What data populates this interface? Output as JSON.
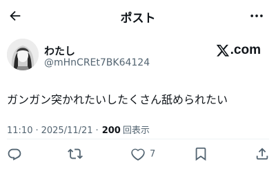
{
  "header": {
    "title": "ポスト",
    "back_icon": "arrow-left-icon",
    "more_icon": "more-horizontal-icon"
  },
  "author": {
    "display_name": "わたし",
    "handle": "@mHnCREt7BK64124"
  },
  "brand": {
    "x_letter": "X",
    "suffix": ".com"
  },
  "tweet": {
    "text": "ガンガン突かれたいしたくさん舐められたい",
    "time": "11:10",
    "separator": "·",
    "date": "2025/11/21",
    "views_count": "200",
    "views_label": "回表示"
  },
  "actions": {
    "reply_icon": "reply-icon",
    "repost_icon": "repost-icon",
    "like_icon": "heart-icon",
    "like_count": "7",
    "bookmark_icon": "bookmark-icon",
    "share_icon": "share-icon"
  },
  "colors": {
    "text_primary": "#0f1419",
    "text_secondary": "#536471",
    "divider": "#eff3f4"
  }
}
